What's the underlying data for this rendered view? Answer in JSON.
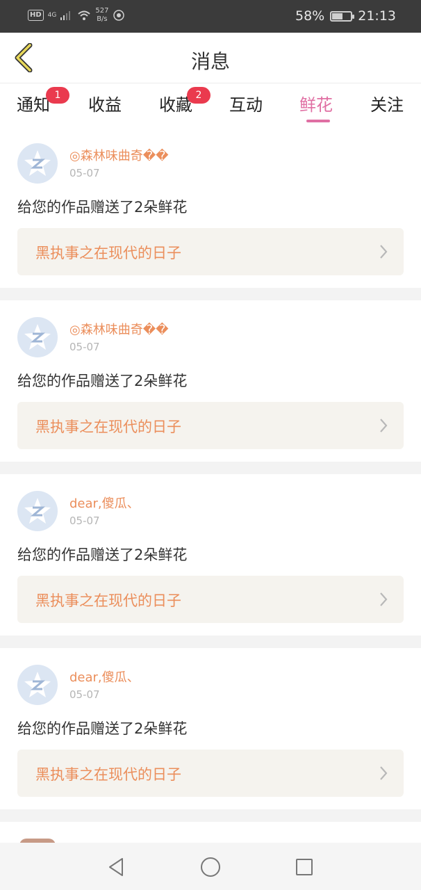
{
  "status_bar": {
    "hd": "HD",
    "network": "4G",
    "speed_value": "527",
    "speed_unit": "B/s",
    "battery": "58%",
    "battery_level": 0.58,
    "time": "21:13"
  },
  "header": {
    "title": "消息"
  },
  "tabs": [
    {
      "label": "通知",
      "badge": "1"
    },
    {
      "label": "收益",
      "badge": ""
    },
    {
      "label": "收藏",
      "badge": "2"
    },
    {
      "label": "互动",
      "badge": ""
    },
    {
      "label": "鲜花",
      "badge": "",
      "active": true
    },
    {
      "label": "关注",
      "badge": ""
    }
  ],
  "messages": [
    {
      "user": "◎森林味曲奇��",
      "date": "05-07",
      "text": "给您的作品赠送了2朵鲜花",
      "work": "黑执事之在现代的日子"
    },
    {
      "user": "◎森林味曲奇��",
      "date": "05-07",
      "text": "给您的作品赠送了2朵鲜花",
      "work": "黑执事之在现代的日子"
    },
    {
      "user": "dear,傻瓜、",
      "date": "05-07",
      "text": "给您的作品赠送了2朵鲜花",
      "work": "黑执事之在现代的日子"
    },
    {
      "user": "dear,傻瓜、",
      "date": "05-07",
      "text": "给您的作品赠送了2朵鲜花",
      "work": "黑执事之在现代的日子"
    }
  ],
  "colors": {
    "accent": "#e06fa3",
    "badge": "#ea3a4e",
    "username": "#eb8e5b",
    "back_arrow": "#c9b84a"
  },
  "icons": {
    "back": "back-arrow-icon",
    "avatar": "default-avatar-icon",
    "chevron": "chevron-right-icon",
    "nav_back": "nav-back-icon",
    "nav_home": "nav-home-icon",
    "nav_recent": "nav-recent-icon"
  }
}
